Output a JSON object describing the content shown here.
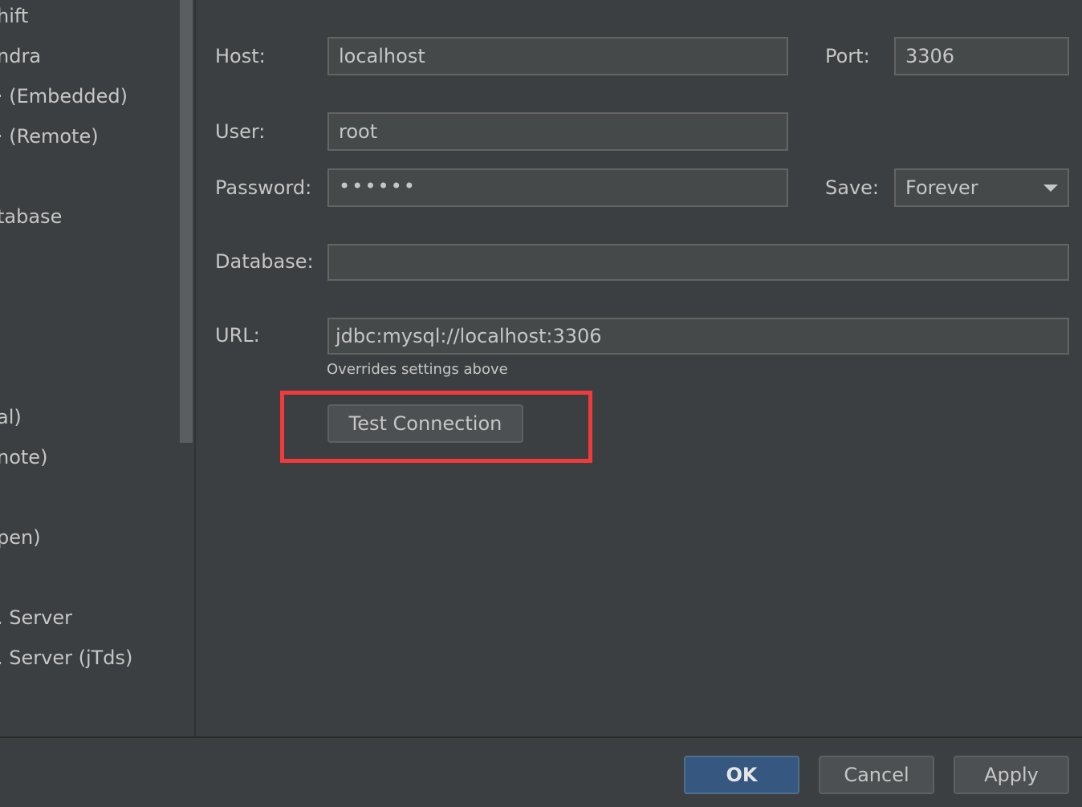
{
  "sidebar": {
    "items": [
      "hift",
      "ndra",
      "(Embedded)",
      "(Remote)",
      "tabase",
      "al)",
      "note)",
      "pen)",
      "Server",
      "Server (jTds)"
    ]
  },
  "form": {
    "host_label": "Host:",
    "host_value": "localhost",
    "port_label": "Port:",
    "port_value": "3306",
    "user_label": "User:",
    "user_value": "root",
    "password_label": "Password:",
    "password_value": "••••••",
    "save_label": "Save:",
    "save_value": "Forever",
    "database_label": "Database:",
    "database_value": "",
    "url_label": "URL:",
    "url_value": "jdbc:mysql://localhost:3306",
    "url_hint": "Overrides settings above",
    "test_connection_label": "Test Connection"
  },
  "footer": {
    "ok_label": "OK",
    "cancel_label": "Cancel",
    "apply_label": "Apply"
  },
  "colors": {
    "background": "#3c3f41",
    "field_bg": "#45494a",
    "ok_button": "#365880",
    "highlight": "#f23a3a"
  }
}
